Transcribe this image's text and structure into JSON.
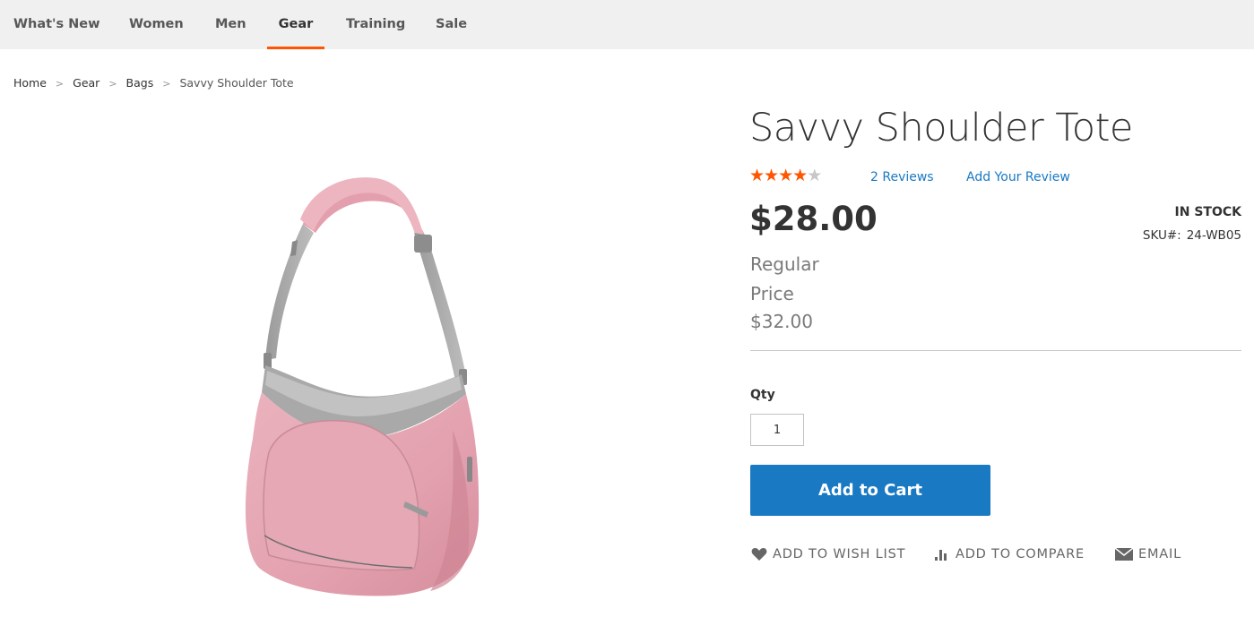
{
  "nav": {
    "items": [
      {
        "label": "What's New"
      },
      {
        "label": "Women"
      },
      {
        "label": "Men"
      },
      {
        "label": "Gear"
      },
      {
        "label": "Training"
      },
      {
        "label": "Sale"
      }
    ],
    "active_item": "Gear"
  },
  "breadcrumb": {
    "items": [
      {
        "label": "Home"
      },
      {
        "label": "Gear"
      },
      {
        "label": "Bags"
      }
    ],
    "current": "Savvy Shoulder Tote",
    "separator": ">"
  },
  "product": {
    "name": "Savvy Shoulder Tote",
    "rating": {
      "stars": 4,
      "max": 5
    },
    "reviews_link": "2 Reviews",
    "add_review_link": "Add Your Review",
    "price": "$28.00",
    "old_price_label": "Regular Price",
    "old_price": "$32.00",
    "stock": "In stock",
    "sku_label": "SKU#:",
    "sku": "24-WB05",
    "image_color": "#e8a9b6"
  },
  "form": {
    "qty_label": "Qty",
    "qty_value": "1",
    "add_to_cart": "Add to Cart"
  },
  "actions": {
    "wishlist": "Add to Wish List",
    "compare": "Add to Compare",
    "email": "Email",
    "wishlist_icon": "heart-icon",
    "compare_icon": "bar-chart-icon",
    "email_icon": "envelope-icon"
  },
  "colors": {
    "accent": "#ff5501",
    "link": "#1979c3",
    "button": "#1979c3"
  }
}
